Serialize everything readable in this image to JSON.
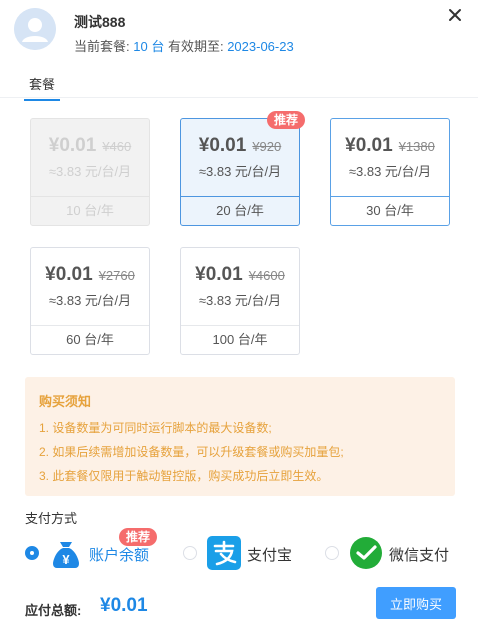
{
  "header": {
    "username": "测试888",
    "plan_prefix": "当前套餐:",
    "plan_devices": "10 台",
    "expiry_prefix": "有效期至:",
    "expiry_date": "2023-06-23",
    "close_icon": "close-icon"
  },
  "tabs": [
    {
      "label": "套餐",
      "active": true
    }
  ],
  "packages": [
    {
      "price": "¥0.01",
      "original": "¥460",
      "per_unit": "≈3.83 元/台/月",
      "count": "10 台/年",
      "state": "disabled",
      "badge": ""
    },
    {
      "price": "¥0.01",
      "original": "¥920",
      "per_unit": "≈3.83 元/台/月",
      "count": "20 台/年",
      "state": "selected",
      "badge": "推荐"
    },
    {
      "price": "¥0.01",
      "original": "¥1380",
      "per_unit": "≈3.83 元/台/月",
      "count": "30 台/年",
      "state": "hover",
      "badge": ""
    },
    {
      "price": "¥0.01",
      "original": "¥2760",
      "per_unit": "≈3.83 元/台/月",
      "count": "60 台/年",
      "state": "normal",
      "badge": ""
    },
    {
      "price": "¥0.01",
      "original": "¥4600",
      "per_unit": "≈3.83 元/台/月",
      "count": "100 台/年",
      "state": "normal",
      "badge": ""
    }
  ],
  "notice": {
    "title": "购买须知",
    "items": [
      "1. 设备数量为可同时运行脚本的最大设备数;",
      "2. 如果后续需增加设备数量，可以升级套餐或购买加量包;",
      "3. 此套餐仅限用于触动智控版，购买成功后立即生效。"
    ]
  },
  "payment": {
    "label": "支付方式",
    "methods": [
      {
        "name": "账户余额",
        "icon": "wallet-icon",
        "checked": true,
        "badge": "推荐"
      },
      {
        "name": "支付宝",
        "icon": "alipay-icon",
        "checked": false,
        "badge": ""
      },
      {
        "name": "微信支付",
        "icon": "wechat-pay-icon",
        "checked": false,
        "badge": ""
      }
    ]
  },
  "footer": {
    "total_label": "应付总额:",
    "total_value": "¥0.01",
    "buy_label": "立即购买"
  },
  "colors": {
    "accent": "#1e88e5",
    "badge": "#f56c6c",
    "notice_text": "#e6a23c",
    "notice_bg": "#fdf1e6"
  }
}
